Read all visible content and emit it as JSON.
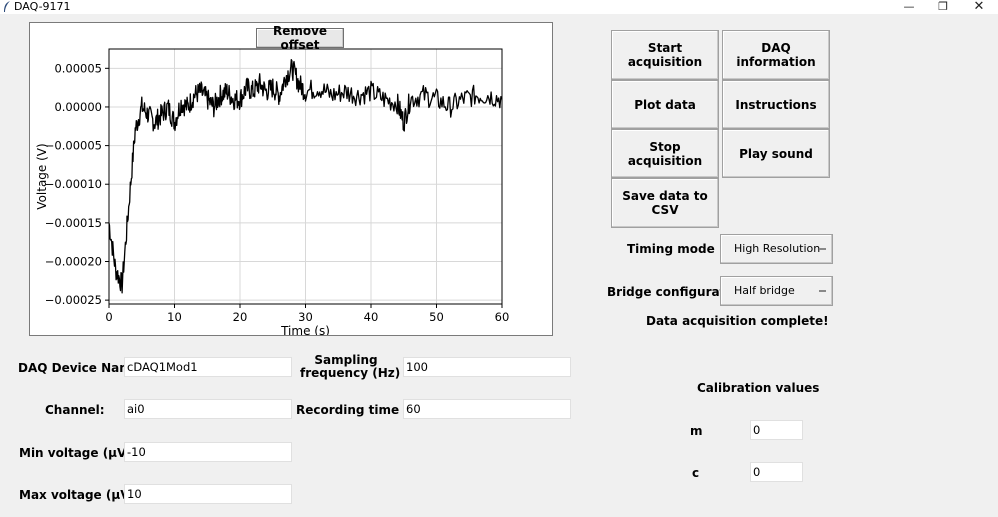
{
  "window": {
    "title": "DAQ-9171",
    "minimize": "—",
    "restore": "❐",
    "close": "✕"
  },
  "plot": {
    "remove_offset_label": "Remove offset",
    "chart_data": {
      "type": "line",
      "xlabel": "Time  (s)",
      "ylabel": "Voltage (V)",
      "xlim": [
        0,
        60
      ],
      "ylim": [
        -0.000255,
        7.5e-05
      ],
      "xticks": [
        "0",
        "10",
        "20",
        "30",
        "40",
        "50",
        "60"
      ],
      "yticks": [
        "0.00005",
        "0.00000",
        "−0.00005",
        "−0.00010",
        "−0.00015",
        "−0.00020",
        "−0.00025"
      ],
      "ytick_values": [
        5e-05,
        0.0,
        -5e-05,
        -0.0001,
        -0.00015,
        -0.0002,
        -0.00025
      ],
      "grid": true,
      "series": [
        {
          "color": "#000000",
          "x": [
            0,
            1,
            2,
            3,
            4,
            5,
            6,
            7,
            8,
            9,
            10,
            11,
            12,
            13,
            14,
            15,
            16,
            17,
            18,
            19,
            20,
            21,
            22,
            23,
            24,
            25,
            26,
            27,
            28,
            29,
            30,
            32,
            34,
            36,
            38,
            40,
            42,
            44,
            45,
            46,
            48,
            50,
            52,
            54,
            56,
            58,
            60
          ],
          "y": [
            -0.00015,
            -0.00021,
            -0.00023,
            -0.00013,
            -3e-05,
            0.0,
            -1e-05,
            -2e-05,
            -1e-05,
            0.0,
            -2e-05,
            5e-06,
            0.0,
            1.5e-05,
            2e-05,
            1e-05,
            0.0,
            1.5e-05,
            2e-05,
            1e-05,
            1e-05,
            2.5e-05,
            2e-05,
            3e-05,
            2e-05,
            2.5e-05,
            1.5e-05,
            4e-05,
            5e-05,
            3e-05,
            2e-05,
            2.5e-05,
            1.5e-05,
            2e-05,
            1.5e-05,
            2e-05,
            1e-05,
            5e-06,
            -2e-05,
            1e-05,
            1.5e-05,
            1e-05,
            0.0,
            1e-05,
            1.5e-05,
            1.5e-05,
            1e-05
          ]
        }
      ]
    }
  },
  "buttons": {
    "start_acquisition": "Start acquisition",
    "daq_information": "DAQ information",
    "plot_data": "Plot data",
    "instructions": "Instructions",
    "stop_acquisition": "Stop acquisition",
    "play_sound": "Play sound",
    "save_csv": "Save data to CSV"
  },
  "settings": {
    "timing_mode_label": "Timing mode",
    "timing_mode_value": "High Resolution",
    "bridge_config_label": "Bridge configuration",
    "bridge_config_value": "Half bridge",
    "status": "Data acquisition complete!"
  },
  "form": {
    "device_name_label": "DAQ Device Name:",
    "device_name_value": "cDAQ1Mod1",
    "channel_label": "Channel:",
    "channel_value": "ai0",
    "min_voltage_label": "Min voltage (μV):",
    "min_voltage_value": "-10",
    "max_voltage_label": "Max voltage (μV):",
    "max_voltage_value": "10",
    "sampling_freq_label_line1": "Sampling",
    "sampling_freq_label_line2": "frequency (Hz)",
    "sampling_freq_value": "100",
    "recording_time_label": "Recording time (s)",
    "recording_time_value": "60"
  },
  "calibration": {
    "title": "Calibration values",
    "m_label": "m",
    "m_value": "0",
    "c_label": "c",
    "c_value": "0"
  }
}
